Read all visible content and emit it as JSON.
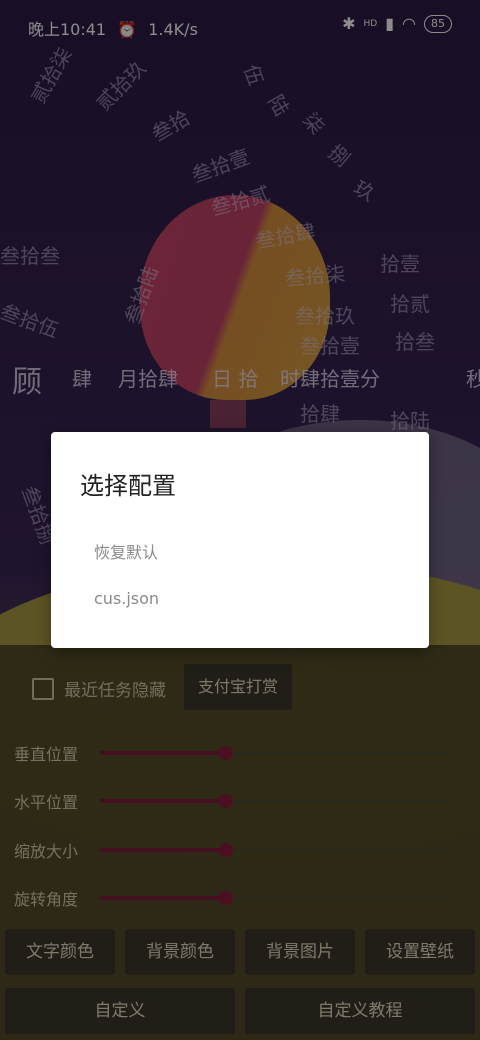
{
  "status_bar": {
    "time": "晚上10:41",
    "alarm_icon": "alarm-clock-icon",
    "net_speed": "1.4K/s",
    "signal_label": "HD",
    "battery": "85"
  },
  "clock_wallpaper": {
    "current_row": [
      "顾",
      "肆",
      "月拾肆",
      "日 拾",
      "时肆拾壹分",
      "秒"
    ],
    "scatter_words": [
      "贰拾柒",
      "贰拾玖",
      "叁拾",
      "叁拾壹",
      "叁拾贰",
      "叁拾叁",
      "叁拾肆",
      "叁拾伍",
      "叁拾陆",
      "叁拾柒",
      "叁拾捌",
      "叁拾玖",
      "拾壹",
      "拾贰",
      "拾叁",
      "拾肆",
      "拾伍",
      "拾陆",
      "伍",
      "陆",
      "柒",
      "捌",
      "玖"
    ]
  },
  "panel": {
    "hide_recent_label": "最近任务隐藏",
    "alipay_label": "支付宝打赏",
    "sliders": [
      {
        "label": "垂直位置",
        "value": 0.36
      },
      {
        "label": "水平位置",
        "value": 0.36
      },
      {
        "label": "缩放大小",
        "value": 0.36
      },
      {
        "label": "旋转角度",
        "value": 0.36
      }
    ],
    "buttons_row1": [
      "文字颜色",
      "背景颜色",
      "背景图片",
      "设置壁纸"
    ],
    "buttons_row2": [
      "自定义",
      "自定义教程"
    ]
  },
  "dialog": {
    "title": "选择配置",
    "items": [
      "恢复默认",
      "cus.json"
    ]
  },
  "colors": {
    "accent": "#8a1c3e",
    "panel": "#4e4626",
    "button": "#3d382c"
  }
}
